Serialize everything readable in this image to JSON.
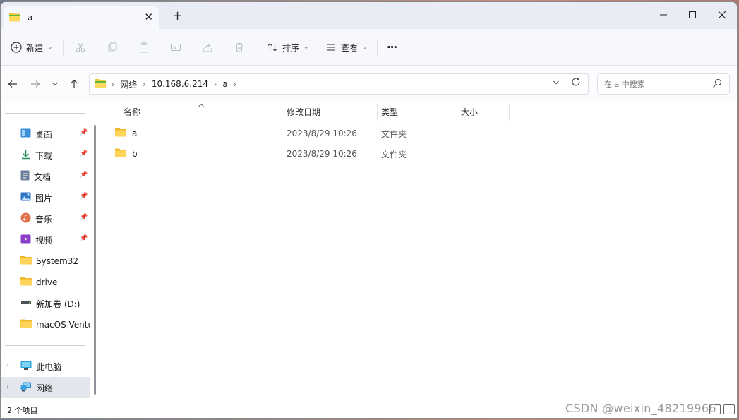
{
  "window": {
    "tab_title": "a",
    "tab_close": "✕",
    "new_tab": "+",
    "minimize": "—",
    "close": "✕"
  },
  "commandbar": {
    "new_label": "新建",
    "sort_label": "排序",
    "view_label": "查看",
    "more_label": "···"
  },
  "address": {
    "breadcrumbs": [
      "网络",
      "10.168.6.214",
      "a"
    ],
    "search_placeholder": "在 a 中搜索"
  },
  "sidebar": {
    "quick_access": [
      {
        "label": "桌面",
        "icon": "desktop-icon",
        "pinned": true
      },
      {
        "label": "下载",
        "icon": "download-icon",
        "pinned": true
      },
      {
        "label": "文档",
        "icon": "document-icon",
        "pinned": true
      },
      {
        "label": "图片",
        "icon": "pictures-icon",
        "pinned": true
      },
      {
        "label": "音乐",
        "icon": "music-icon",
        "pinned": true
      },
      {
        "label": "视频",
        "icon": "video-icon",
        "pinned": true
      },
      {
        "label": "System32",
        "icon": "folder-icon",
        "pinned": false
      },
      {
        "label": "drive",
        "icon": "folder-icon",
        "pinned": false
      },
      {
        "label": "新加卷 (D:)",
        "icon": "drive-icon",
        "pinned": false
      },
      {
        "label": "macOS Ventura",
        "icon": "folder-icon",
        "pinned": false
      }
    ],
    "this_pc": {
      "label": "此电脑",
      "icon": "computer-icon"
    },
    "network": {
      "label": "网络",
      "icon": "network-icon",
      "selected": true
    }
  },
  "filelist": {
    "columns": [
      "名称",
      "修改日期",
      "类型",
      "大小"
    ],
    "rows": [
      {
        "name": "a",
        "modified": "2023/8/29 10:26",
        "type": "文件夹",
        "size": ""
      },
      {
        "name": "b",
        "modified": "2023/8/29 10:26",
        "type": "文件夹",
        "size": ""
      }
    ]
  },
  "status": {
    "item_count": "2 个项目"
  },
  "watermark": "CSDN @weixin_48219966"
}
